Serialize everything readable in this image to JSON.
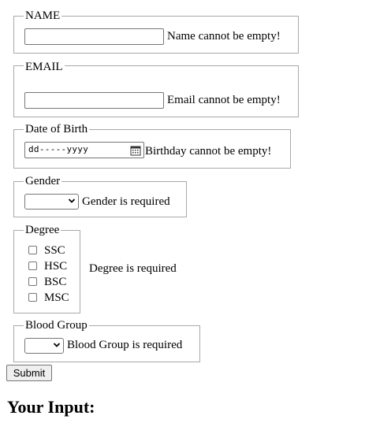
{
  "form": {
    "name": {
      "legend": "NAME",
      "value": "",
      "error": "Name cannot be empty!"
    },
    "email": {
      "legend": "EMAIL",
      "value": "",
      "error": "Email cannot be empty!"
    },
    "dob": {
      "legend": "Date of Birth",
      "placeholder": "dd-----yyyy",
      "error": "Birthday cannot be empty!"
    },
    "gender": {
      "legend": "Gender",
      "selected": "",
      "error": "Gender is required"
    },
    "degree": {
      "legend": "Degree",
      "options": [
        "SSC",
        "HSC",
        "BSC",
        "MSC"
      ],
      "error": "Degree is required"
    },
    "blood_group": {
      "legend": "Blood Group",
      "selected": "",
      "error": "Blood Group is required"
    },
    "submit_label": "Submit"
  },
  "output": {
    "heading": "Your Input:"
  },
  "icons": {
    "dropdown": "chevron-down-icon",
    "calendar": "calendar-icon"
  }
}
